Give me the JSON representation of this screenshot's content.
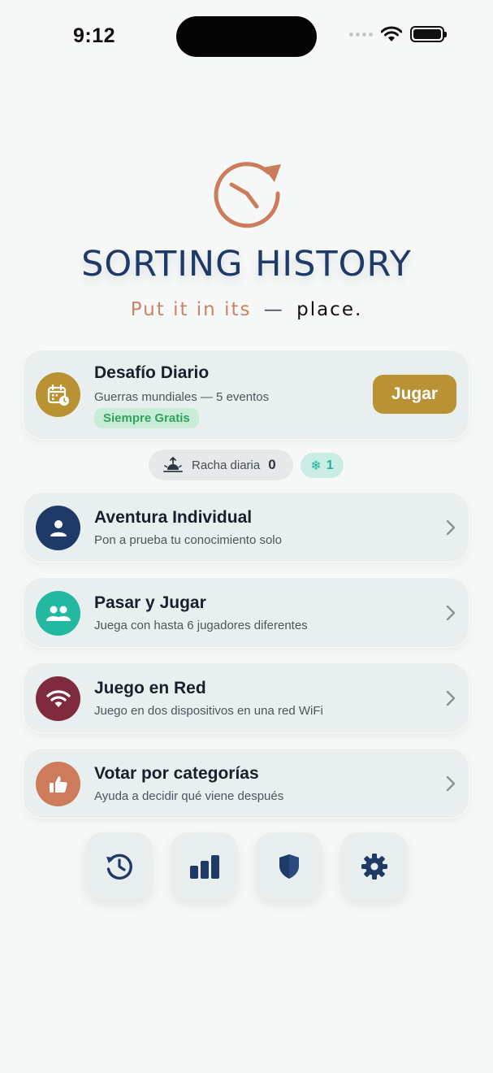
{
  "status_bar": {
    "time": "9:12"
  },
  "header": {
    "title": "SORTING HISTORY",
    "tagline_part1": "Put it in its",
    "tagline_dash": "—",
    "tagline_part2": "place.",
    "logo_icon": "clock-restart-icon"
  },
  "daily_challenge": {
    "title": "Desafío Diario",
    "subtitle": "Guerras mundiales — 5 eventos",
    "badge": "Siempre Gratis",
    "play_label": "Jugar",
    "icon": "calendar-clock-icon"
  },
  "streak": {
    "label": "Racha diaria",
    "value": "0",
    "freeze_count": "1"
  },
  "modes": [
    {
      "title": "Aventura Individual",
      "subtitle": "Pon a prueba tu conocimiento solo",
      "icon": "person-icon"
    },
    {
      "title": "Pasar y Jugar",
      "subtitle": "Juega con hasta 6 jugadores diferentes",
      "icon": "group-icon"
    },
    {
      "title": "Juego en Red",
      "subtitle": "Juego en dos dispositivos en una red WiFi",
      "icon": "wifi-icon"
    },
    {
      "title": "Votar por categorías",
      "subtitle": "Ayuda a decidir qué viene después",
      "icon": "thumbs-up-icon"
    }
  ],
  "colors": {
    "navy": "#1f3a66",
    "gold": "#b99234",
    "teal": "#23b9a1",
    "maroon": "#7f2a3f",
    "terracotta": "#cc7b5b",
    "card_bg": "#e9efee",
    "page_bg": "#f6f8f7"
  },
  "bottom_nav": [
    "history-icon",
    "stats-icon",
    "shield-icon",
    "settings-icon"
  ]
}
